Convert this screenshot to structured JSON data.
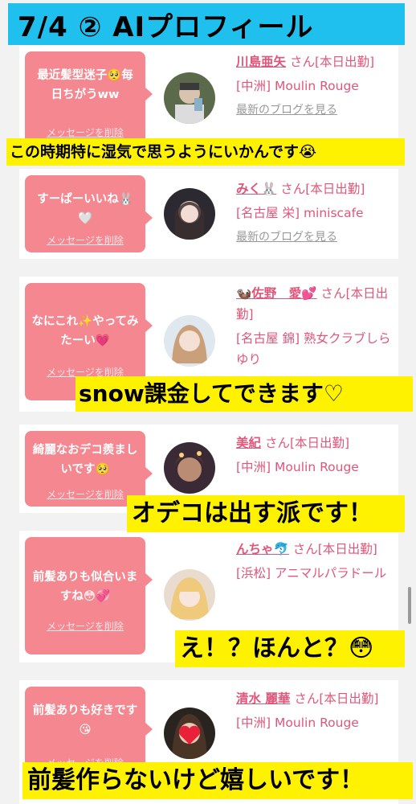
{
  "header": {
    "title": "7/4 ② AIプロフィール"
  },
  "cards": [
    {
      "message": "最近髪型迷子🥺毎日ちがうww",
      "delete_label": "メッセージを削除",
      "name": "川島亜矢",
      "san": "さん[本日出勤]",
      "shop": "[中洲] Moulin Rouge",
      "blog": "最新のブログを見る",
      "caption": "この時期特に湿気で思うようにいかんです😭"
    },
    {
      "message": "すーぱーいいね🐰🤍",
      "delete_label": "メッセージを削除",
      "name": "みく🐰",
      "san": "さん[本日出勤]",
      "shop": "[名古屋 栄] miniscafe",
      "blog": "最新のブログを見る"
    },
    {
      "message": "なにこれ✨やってみたーい💗",
      "delete_label": "メッセージを削除",
      "name": "🦦佐野　愛💕",
      "san": "さん[本日出勤]",
      "shop": "[名古屋 錦] 熟女クラブしらゆり",
      "caption": "snow課金してできます♡"
    },
    {
      "message": "綺麗なおデコ羨ましいです🥺",
      "delete_label": "メッセージを削除",
      "name": "美紀",
      "san": "さん[本日出勤]",
      "shop": "[中洲] Moulin Rouge",
      "caption": "オデコは出す派です！"
    },
    {
      "message": "前髪ありも似合いますね😳💞",
      "delete_label": "メッセージを削除",
      "name": "んちゃ🐬",
      "san": "さん[本日出勤]",
      "shop": "[浜松] アニマルパラドール",
      "caption": "え！？ほんと？😳"
    },
    {
      "message": "前髪ありも好きです😘",
      "delete_label": "メッセージを削除",
      "name": "清水 麗華",
      "san": "さん[本日出勤]",
      "shop": "[中洲] Moulin Rouge",
      "caption": "前髪作らないけど嬉しいです！"
    }
  ],
  "colors": {
    "banner": "#1fc0ee",
    "bubble": "#f4878f",
    "caption": "#fff200",
    "name": "#e0567a"
  }
}
